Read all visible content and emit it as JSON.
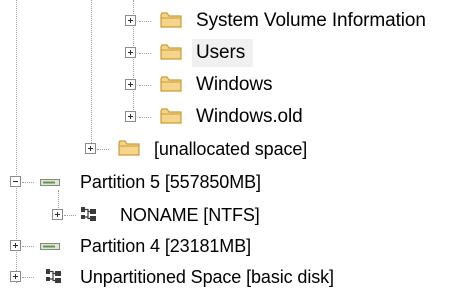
{
  "tree": {
    "items": [
      {
        "label": "System Volume Information",
        "icon": "folder-icon",
        "expander": "plus"
      },
      {
        "label": "Users",
        "icon": "folder-icon",
        "expander": "plus",
        "selected": true
      },
      {
        "label": "Windows",
        "icon": "folder-icon",
        "expander": "plus"
      },
      {
        "label": "Windows.old",
        "icon": "folder-icon",
        "expander": "plus"
      },
      {
        "label": "[unallocated space]",
        "icon": "folder-icon",
        "expander": "plus"
      },
      {
        "label": "Partition 5 [557850MB]",
        "icon": "disk-partition-icon",
        "expander": "minus"
      },
      {
        "label": "NONAME [NTFS]",
        "icon": "network-volume-icon",
        "expander": "plus"
      },
      {
        "label": "Partition 4 [23181MB]",
        "icon": "disk-partition-icon",
        "expander": "plus"
      },
      {
        "label": "Unpartitioned Space [basic disk]",
        "icon": "network-volume-icon",
        "expander": "plus"
      }
    ]
  },
  "colors": {
    "folder_fill": "#f6d58a",
    "folder_stroke": "#c79d38",
    "disk_fill": "#6f8f5a",
    "tree_lines": "#a0a0a0"
  }
}
